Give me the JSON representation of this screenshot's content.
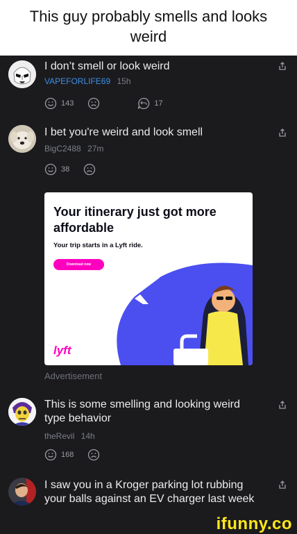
{
  "caption": {
    "line1": "This guy probably smells and looks",
    "line2": "weird"
  },
  "comments": [
    {
      "text": "I don’t smell or look weird",
      "user": "VAPEFORLIFE69",
      "time": "15h",
      "upvotes": "143",
      "replies": "17"
    },
    {
      "text": "I bet you're weird and look smell",
      "user": "BigC2488",
      "time": "27m",
      "upvotes": "38"
    },
    {
      "text": "This is some smelling and looking weird type behavior",
      "user": "theRevil",
      "time": "14h",
      "upvotes": "168"
    },
    {
      "text": "I saw you in a Kroger parking lot rubbing your balls against an EV charger last week"
    }
  ],
  "ad": {
    "title": "Your itinerary just got more affordable",
    "subtitle": "Your trip starts in a Lyft ride.",
    "button": "Download now",
    "logo": "lyft",
    "label": "Advertisement"
  },
  "watermark": "ifunny.co",
  "colors": {
    "background": "#1b1b1e",
    "username_highlight": "#3d8fe6",
    "ad_accent": "#ff00bf",
    "ad_illustration": "#4b4ff0",
    "watermark": "#ffe71a"
  },
  "icons": [
    "stormtrooper-avatar-icon",
    "dog-avatar-icon",
    "skeletor-avatar-icon",
    "person-avatar-icon",
    "share-icon",
    "smile-upvote-icon",
    "frown-downvote-icon",
    "reply-bubble-icon",
    "airplane-icon"
  ]
}
